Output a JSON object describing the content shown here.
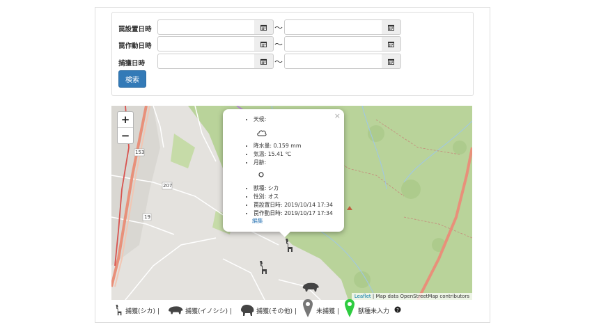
{
  "form": {
    "rows": [
      {
        "label": "罠設置日時",
        "from": "",
        "to": ""
      },
      {
        "label": "罠作動日時",
        "from": "",
        "to": ""
      },
      {
        "label": "捕獲日時",
        "from": "",
        "to": ""
      }
    ],
    "range_separator": "～",
    "search_label": "検索"
  },
  "map": {
    "zoom_in": "+",
    "zoom_out": "−",
    "road_labels": [
      "153",
      "207",
      "19"
    ],
    "attribution_link": "Leaflet",
    "attribution_text": " | Map data OpenStreetMap contributors"
  },
  "popup": {
    "close": "×",
    "weather_label": "天候:",
    "weather_icon": "cloud-icon",
    "rainfall": "降水量: 0.159 mm",
    "temperature": "気温: 15.41 ℃",
    "moon_label": "月齢:",
    "moon_icon": "moon-phase-icon",
    "species": "獣種: シカ",
    "sex": "性別: オス",
    "set_time": "罠設置日時: 2019/10/14 17:34",
    "trigger_time": "罠作動日時: 2019/10/17 17:34",
    "edit_label": "編集"
  },
  "legend": {
    "deer": "捕獲(シカ) |",
    "boar": "捕獲(イノシシ) |",
    "other": "捕獲(その他) |",
    "uncaptured": "未捕獲 |",
    "unspecified": "獣種未入力",
    "help_icon": "question-circle-icon"
  },
  "colors": {
    "primary": "#337ab7",
    "map_green": "#b9d39a",
    "road_orange": "#e8907a",
    "marker_gray": "#777777",
    "marker_green": "#2ecc40"
  }
}
